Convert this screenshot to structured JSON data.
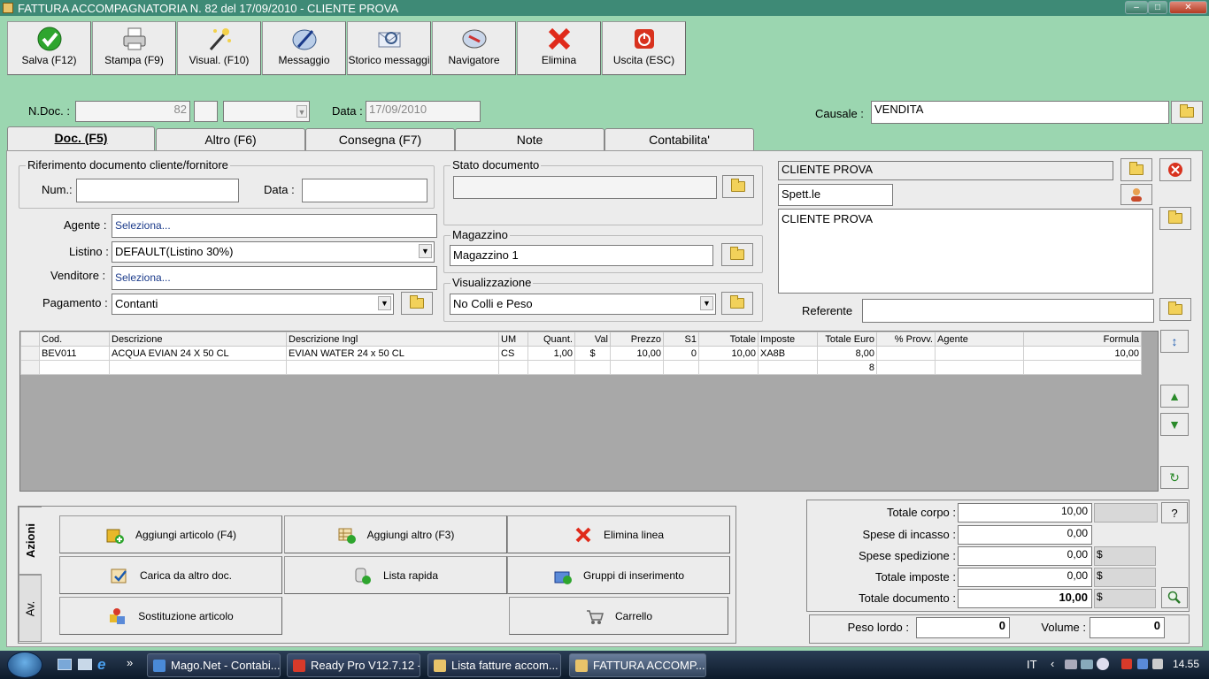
{
  "window": {
    "title": "FATTURA ACCOMPAGNATORIA N. 82  del 17/09/2010 - CLIENTE PROVA"
  },
  "toolbar": [
    {
      "label": "Salva (F12)",
      "icon": "save-check-icon"
    },
    {
      "label": "Stampa (F9)",
      "icon": "printer-icon"
    },
    {
      "label": "Visual. (F10)",
      "icon": "magic-wand-icon"
    },
    {
      "label": "Messaggio",
      "icon": "message-pen-icon"
    },
    {
      "label": "Storico messaggi",
      "icon": "message-history-icon"
    },
    {
      "label": "Navigatore",
      "icon": "compass-icon"
    },
    {
      "label": "Elimina",
      "icon": "delete-x-icon"
    },
    {
      "label": "Uscita (ESC)",
      "icon": "power-icon"
    }
  ],
  "header": {
    "ndoc_label": "N.Doc. :",
    "ndoc_value": "82",
    "data_label": "Data :",
    "data_value": "17/09/2010",
    "causale_label": "Causale :",
    "causale_value": "VENDITA"
  },
  "tabs": [
    "Doc. (F5)",
    "Altro (F6)",
    "Consegna (F7)",
    "Note",
    "Contabilita'"
  ],
  "riferimento": {
    "title": "Riferimento documento cliente/fornitore",
    "num_label": "Num.:",
    "data_label": "Data :"
  },
  "fields": {
    "agente_label": "Agente :",
    "agente_value": "Seleziona...",
    "listino_label": "Listino :",
    "listino_value": "DEFAULT(Listino 30%)",
    "venditore_label": "Venditore :",
    "venditore_value": "Seleziona...",
    "pagamento_label": "Pagamento :",
    "pagamento_value": "Contanti"
  },
  "stato": {
    "title": "Stato documento"
  },
  "magazzino": {
    "title": "Magazzino",
    "value": "Magazzino 1"
  },
  "visualizzazione": {
    "title": "Visualizzazione",
    "value": "No Colli e Peso"
  },
  "cliente": {
    "name": "CLIENTE PROVA",
    "title": "Spett.le",
    "address": "CLIENTE PROVA",
    "referente_label": "Referente"
  },
  "grid": {
    "columns": [
      "Cod.",
      "Descrizione",
      "Descrizione Ingl",
      "UM",
      "Quant.",
      "Val",
      "Prezzo",
      "S1",
      "Totale",
      "Imposte",
      "Totale Euro",
      "% Provv.",
      "Agente",
      "Formula"
    ],
    "rows": [
      [
        "BEV011",
        "ACQUA EVIAN 24 X 50 CL",
        "EVIAN WATER 24 x 50 CL",
        "CS",
        "1,00",
        "$",
        "10,00",
        "0",
        "10,00",
        "XA8B",
        "8,00",
        "",
        "",
        "10,00"
      ],
      [
        "",
        "",
        "",
        "",
        "",
        "",
        "",
        "",
        "",
        "",
        "8",
        "",
        "",
        ""
      ]
    ]
  },
  "actions": {
    "tab_azioni": "Azioni",
    "tab_av": "Av.",
    "buttons": [
      {
        "label": "Aggiungi articolo (F4)",
        "icon": "add-article-icon"
      },
      {
        "label": "Aggiungi altro (F3)",
        "icon": "add-other-icon"
      },
      {
        "label": "Elimina linea",
        "icon": "delete-line-icon"
      },
      {
        "label": "Carica da altro doc.",
        "icon": "load-doc-icon"
      },
      {
        "label": "Lista rapida",
        "icon": "quick-list-icon"
      },
      {
        "label": "Gruppi di inserimento",
        "icon": "insert-groups-icon"
      },
      {
        "label": "Sostituzione articolo",
        "icon": "replace-article-icon"
      },
      {
        "label": "Carrello",
        "icon": "cart-icon"
      }
    ]
  },
  "totals": {
    "corpo_label": "Totale corpo :",
    "corpo_value": "10,00",
    "incasso_label": "Spese di incasso :",
    "incasso_value": "0,00",
    "spedizione_label": "Spese spedizione :",
    "spedizione_value": "0,00",
    "spedizione_cur": "$",
    "imposte_label": "Totale imposte :",
    "imposte_value": "0,00",
    "imposte_cur": "$",
    "documento_label": "Totale documento :",
    "documento_value": "10,00",
    "documento_cur": "$",
    "help": "?",
    "peso_label": "Peso lordo :",
    "peso_value": "0",
    "volume_label": "Volume :",
    "volume_value": "0"
  },
  "taskbar": {
    "items": [
      "Mago.Net - Contabi...",
      "Ready Pro V12.7.12 - ...",
      "Lista fatture accom...",
      "FATTURA ACCOMP..."
    ],
    "lang": "IT",
    "clock": "14.55"
  }
}
